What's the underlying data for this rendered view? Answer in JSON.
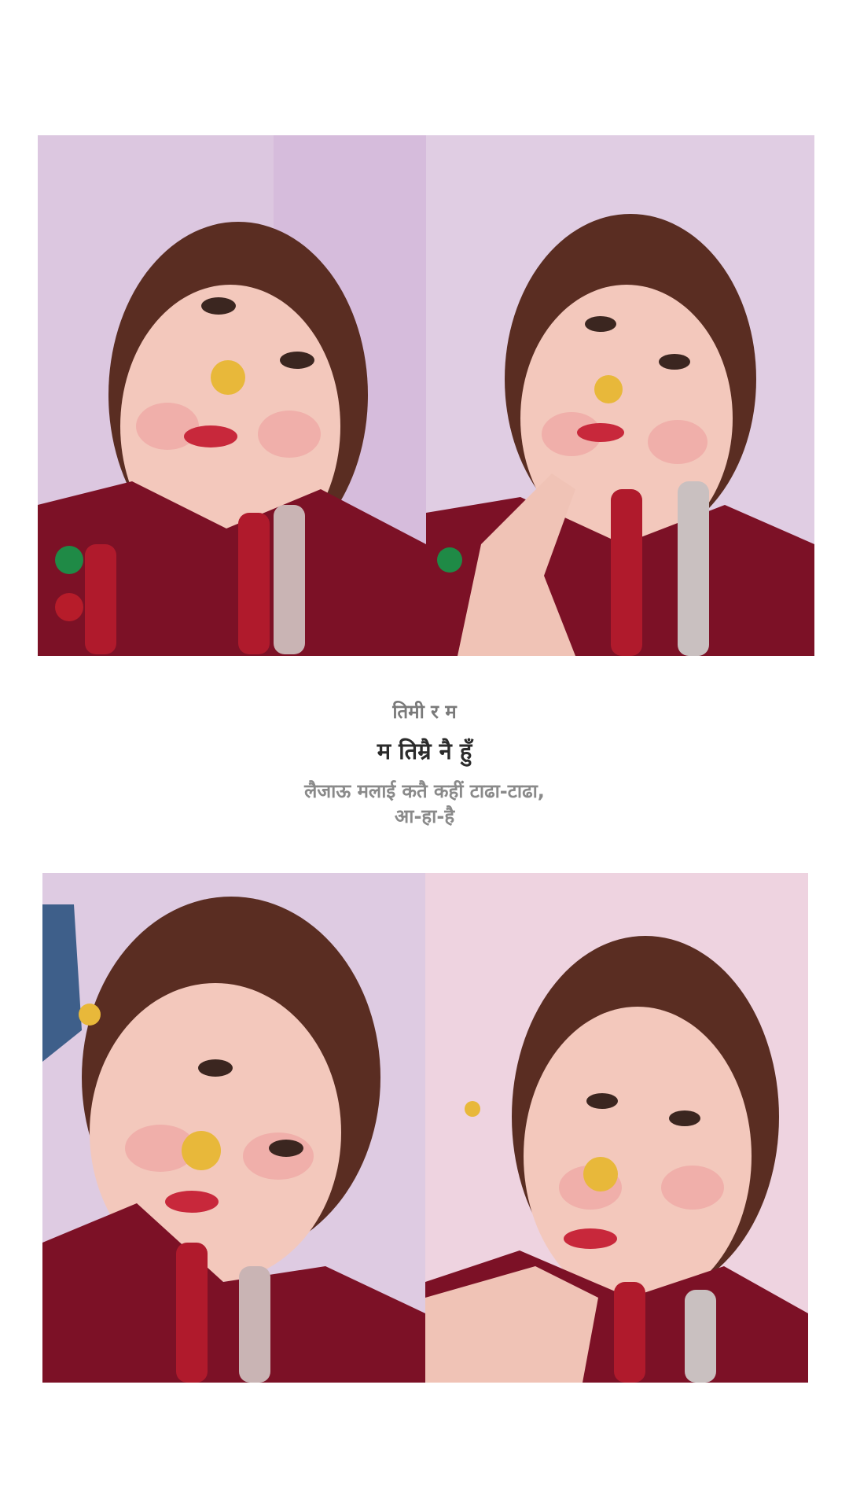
{
  "song": {
    "label": "तिमी र म",
    "title": "म तिम्रै नै हुँ",
    "lyrics": [
      "लैजाऊ मलाई कतै कहीं टाढा-टाढा,",
      "आ-हा-है"
    ]
  },
  "photos": [
    {
      "name": "selfie-1"
    },
    {
      "name": "selfie-2"
    },
    {
      "name": "selfie-3"
    },
    {
      "name": "selfie-4"
    }
  ],
  "colors": {
    "background": "#ffffff",
    "wall": "#dcc6e0",
    "dress": "#7c1126",
    "skin": "#f1c2b4",
    "hair": "#5a2d22",
    "gold": "#e8b83a"
  }
}
